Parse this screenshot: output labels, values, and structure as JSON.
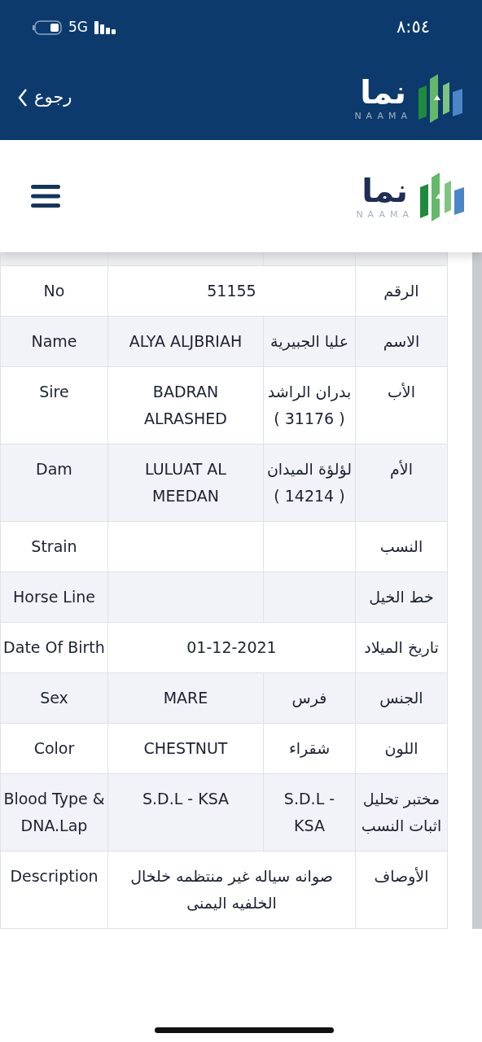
{
  "status_bar": {
    "time": "٨:٥٤",
    "network": "5G"
  },
  "app_bar": {
    "back_label": "رجوع",
    "logo_text": "نما",
    "logo_subtext": "NAAMA"
  },
  "navbar": {
    "logo_text": "نما",
    "logo_subtext": "NAAMA"
  },
  "table": {
    "rows": [
      {
        "kind": "merged",
        "label_ar": "الرقم",
        "value": "51155",
        "label_en": "No"
      },
      {
        "kind": "split",
        "label_ar": "الاسم",
        "value_ar": "عليا الجبيرية",
        "value_en": "ALYA ALJBRIAH",
        "label_en": "Name"
      },
      {
        "kind": "split",
        "label_ar": "الأب",
        "value_ar": "بدران الراشد ( 31176 )",
        "value_en": "BADRAN ALRASHED",
        "label_en": "Sire"
      },
      {
        "kind": "split",
        "label_ar": "الأم",
        "value_ar": "لؤلؤة الميدان ( 14214 )",
        "value_en": "LULUAT AL MEEDAN",
        "label_en": "Dam"
      },
      {
        "kind": "split",
        "label_ar": "النسب",
        "label_en": "Strain"
      },
      {
        "kind": "split",
        "label_ar": "خط الخيل",
        "label_en": "Horse Line"
      },
      {
        "kind": "merged",
        "label_ar": "تاريخ الميلاد",
        "value": "01-12-2021",
        "label_en": "Date Of Birth"
      },
      {
        "kind": "split",
        "label_ar": "الجنس",
        "value_ar": "فرس",
        "value_en": "MARE",
        "label_en": "Sex"
      },
      {
        "kind": "split",
        "label_ar": "اللون",
        "value_ar": "شقراء",
        "value_en": "CHESTNUT",
        "label_en": "Color"
      },
      {
        "kind": "split",
        "label_ar": "مختبر تحليل اثبات النسب",
        "value_ar": "S.D.L - KSA",
        "value_en": "S.D.L - KSA",
        "label_en": "Blood Type & DNA.Lap"
      },
      {
        "kind": "merged",
        "label_ar": "الأوصاف",
        "value": "صوانه سياله غير منتظمه خلخال الخلفيه اليمنى",
        "label_en": "Description"
      }
    ]
  }
}
